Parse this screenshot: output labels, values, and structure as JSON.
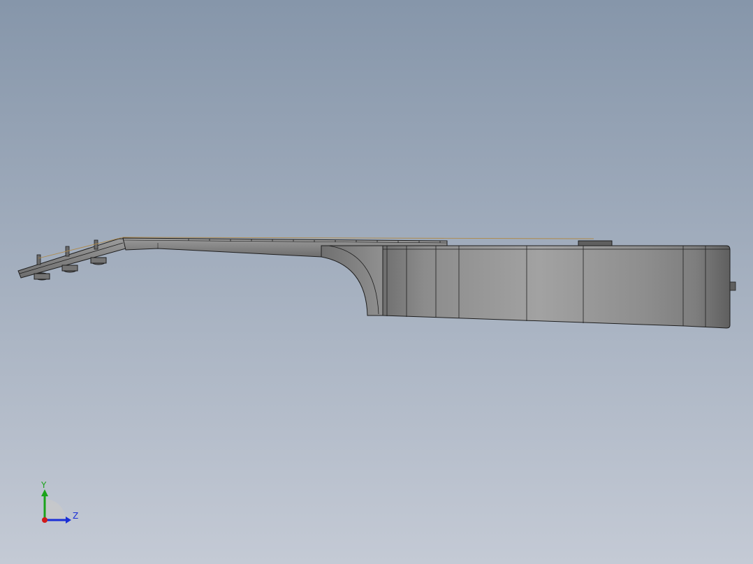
{
  "viewport": {
    "background_top": "#8696aa",
    "background_bottom": "#c4cad5"
  },
  "model": {
    "name": "guitar-side-view",
    "body_color": "#8a8a8a",
    "edge_color": "#1e1e1e",
    "string_color": "#b08a4a"
  },
  "triad": {
    "y_label": "Y",
    "z_label": "Z",
    "y_color": "#1aa31a",
    "z_color": "#1a2fd6",
    "x_color": "#d11a1a"
  }
}
